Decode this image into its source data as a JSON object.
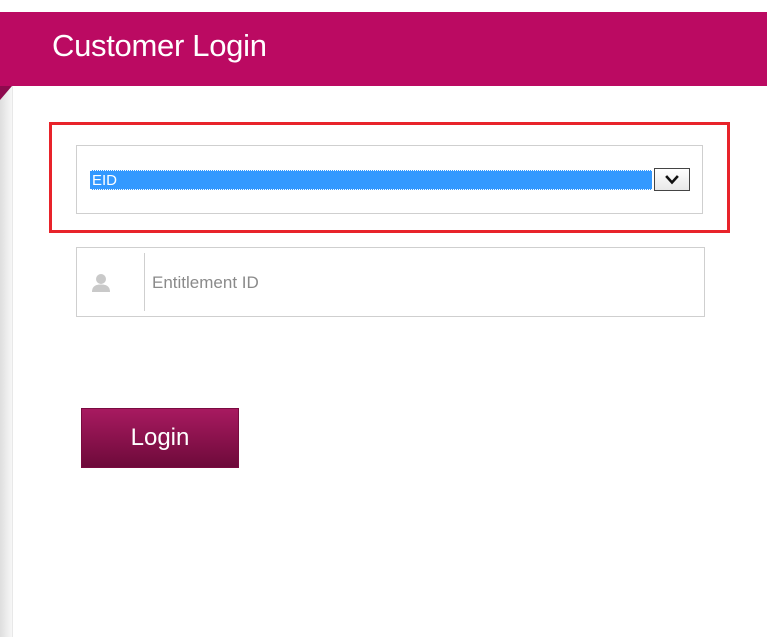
{
  "header": {
    "title": "Customer Login"
  },
  "login_type": {
    "selected": "EID"
  },
  "entitlement": {
    "value": "",
    "placeholder": "Entitlement ID"
  },
  "actions": {
    "login_label": "Login"
  },
  "colors": {
    "brand": "#bb0a62",
    "highlight": "#e8232a",
    "selection": "#3399ff",
    "button": "#8e0a4e"
  },
  "icons": {
    "input": "user-icon",
    "select": "chevron-down-icon"
  }
}
